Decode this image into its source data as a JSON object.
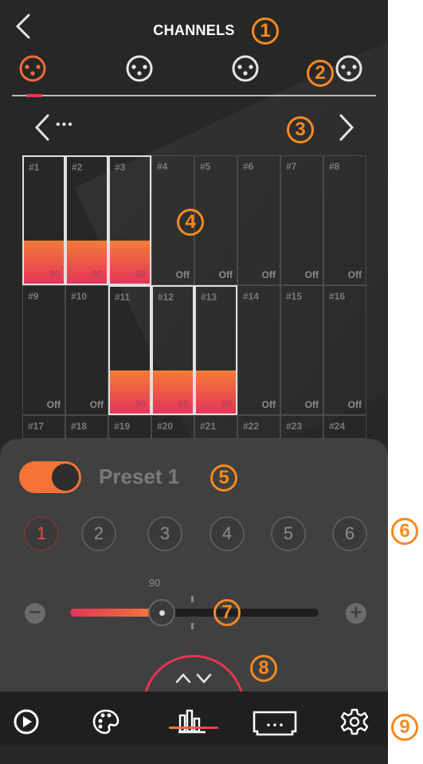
{
  "header": {
    "title": "CHANNELS"
  },
  "device_tabs": [
    {
      "name": "device-tab-1",
      "active": true
    },
    {
      "name": "device-tab-2"
    },
    {
      "name": "device-tab-3"
    },
    {
      "name": "device-tab-4"
    }
  ],
  "pager": {
    "ellipsis": "•••"
  },
  "channels": [
    {
      "num": "#1",
      "val": "90",
      "level": 0.34,
      "selected": true
    },
    {
      "num": "#2",
      "val": "90",
      "level": 0.34,
      "selected": true
    },
    {
      "num": "#3",
      "val": "90",
      "level": 0.34,
      "selected": true
    },
    {
      "num": "#4",
      "val": "Off",
      "level": 0
    },
    {
      "num": "#5",
      "val": "Off",
      "level": 0
    },
    {
      "num": "#6",
      "val": "Off",
      "level": 0
    },
    {
      "num": "#7",
      "val": "Off",
      "level": 0
    },
    {
      "num": "#8",
      "val": "Off",
      "level": 0
    },
    {
      "num": "#9",
      "val": "Off",
      "level": 0
    },
    {
      "num": "#10",
      "val": "Off",
      "level": 0
    },
    {
      "num": "#11",
      "val": "90",
      "level": 0.34,
      "selected": true
    },
    {
      "num": "#12",
      "val": "90",
      "level": 0.34,
      "selected": true
    },
    {
      "num": "#13",
      "val": "90",
      "level": 0.34,
      "selected": true
    },
    {
      "num": "#14",
      "val": "Off",
      "level": 0
    },
    {
      "num": "#15",
      "val": "Off",
      "level": 0
    },
    {
      "num": "#16",
      "val": "Off",
      "level": 0
    },
    {
      "num": "#17",
      "val": ""
    },
    {
      "num": "#18",
      "val": ""
    },
    {
      "num": "#19",
      "val": ""
    },
    {
      "num": "#20",
      "val": ""
    },
    {
      "num": "#21",
      "val": ""
    },
    {
      "num": "#22",
      "val": ""
    },
    {
      "num": "#23",
      "val": ""
    },
    {
      "num": "#24",
      "val": ""
    }
  ],
  "preset": {
    "name": "Preset 1",
    "enabled": true,
    "buttons": [
      "1",
      "2",
      "3",
      "4",
      "5",
      "6"
    ]
  },
  "slider": {
    "value": "90",
    "level": 0.36
  },
  "bottom_nav": [
    {
      "name": "play-icon"
    },
    {
      "name": "palette-icon"
    },
    {
      "name": "equalizer-icon",
      "active": true
    },
    {
      "name": "stage-icon"
    },
    {
      "name": "settings-icon"
    }
  ],
  "callouts": [
    "1",
    "2",
    "3",
    "4",
    "5",
    "6",
    "7",
    "8",
    "9"
  ],
  "colors": {
    "accent_orange": "#f47c36",
    "accent_red": "#e4355a",
    "callout": "#f48a1f"
  }
}
